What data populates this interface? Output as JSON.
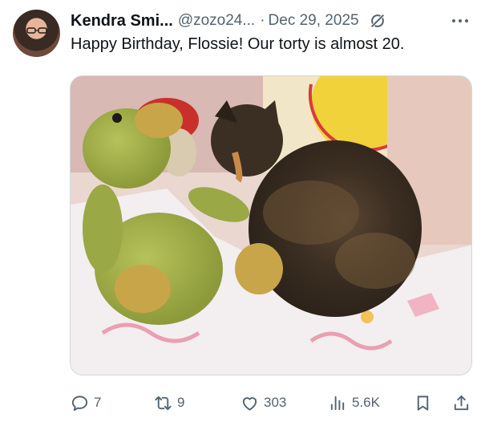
{
  "author": {
    "display_name": "Kendra Smi...",
    "handle": "@zozo24...",
    "separator": "·",
    "date": "Dec 29, 2025"
  },
  "tweet": {
    "text": "Happy Birthday, Flossie! Our torty is almost 20."
  },
  "media": {
    "icon": "photo-cat-with-plush-duck"
  },
  "actions": {
    "replies": "7",
    "reposts": "9",
    "likes": "303",
    "views": "5.6K"
  },
  "colors": {
    "text_primary": "#0f1419",
    "text_secondary": "#536471",
    "border": "#cfd9de"
  }
}
